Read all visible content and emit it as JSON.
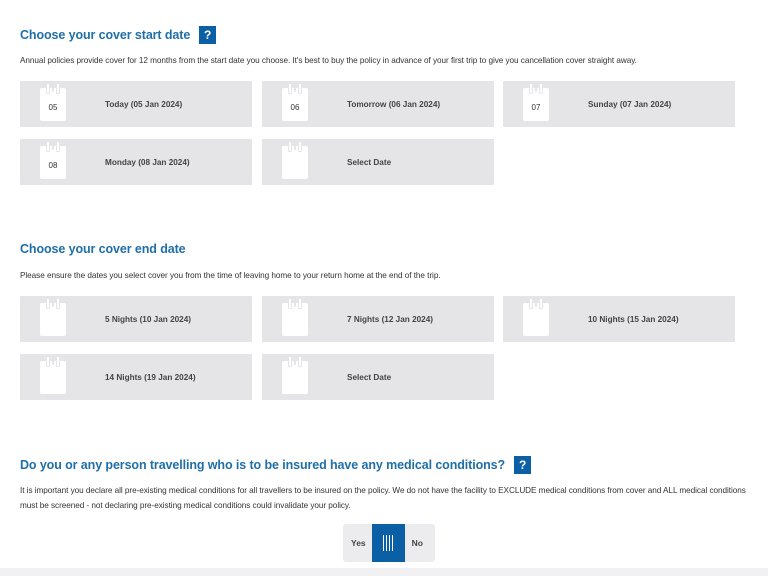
{
  "start_section": {
    "title": "Choose your cover start date",
    "help_label": "?",
    "description": "Annual policies provide cover for 12 months from the start date you choose. It's best to buy the policy in advance of your first trip to give you cancellation cover straight away.",
    "options": [
      {
        "day": "05",
        "label": "Today (05 Jan 2024)"
      },
      {
        "day": "06",
        "label": "Tomorrow (06 Jan 2024)"
      },
      {
        "day": "07",
        "label": "Sunday (07 Jan 2024)"
      },
      {
        "day": "08",
        "label": "Monday (08 Jan 2024)"
      },
      {
        "day": "",
        "label": "Select Date"
      }
    ]
  },
  "end_section": {
    "title": "Choose your cover end date",
    "description": "Please ensure the dates you select cover you from the time of leaving home to your return home at the end of the trip.",
    "options": [
      {
        "day": "",
        "label": "5 Nights (10 Jan 2024)"
      },
      {
        "day": "",
        "label": "7 Nights (12 Jan 2024)"
      },
      {
        "day": "",
        "label": "10 Nights (15 Jan 2024)"
      },
      {
        "day": "",
        "label": "14 Nights (19 Jan 2024)"
      },
      {
        "day": "",
        "label": "Select Date"
      }
    ]
  },
  "medical_section": {
    "title": "Do you or any person travelling who is to be insured have any medical conditions?",
    "help_label": "?",
    "description_line1": "It is important you declare all pre-existing medical conditions for all travellers to be insured on the policy. We do not have the facility to EXCLUDE medical conditions from cover and ALL medical conditions",
    "description_line2": "must be screened - not declaring pre-existing medical conditions could invalidate your policy.",
    "toggle": {
      "yes_label": "Yes",
      "no_label": "No"
    }
  },
  "colors": {
    "heading": "#1f6fa8",
    "accent": "#0b5fa5",
    "tile_bg": "#e5e5e8"
  },
  "icons": {
    "calendar": "calendar-icon",
    "help": "help-icon",
    "drag_handle": "drag-handle-icon"
  }
}
